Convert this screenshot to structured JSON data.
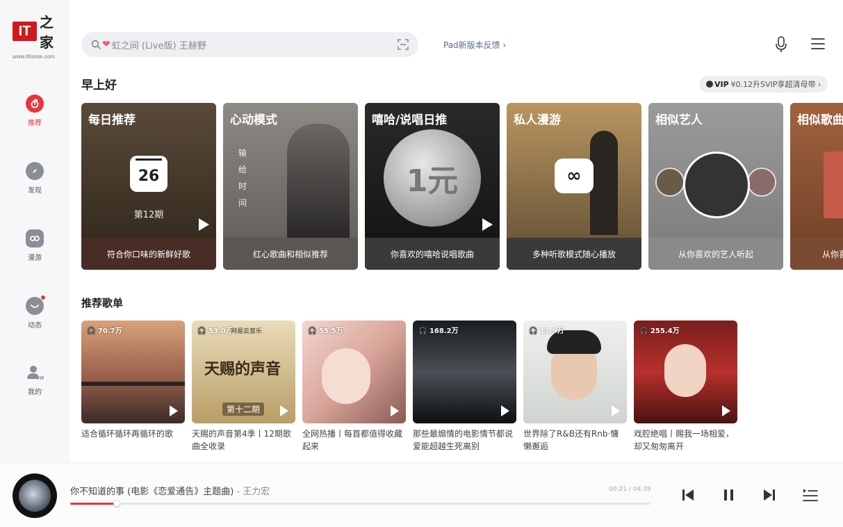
{
  "logo": {
    "brand_mark": "IT",
    "brand_cn": "之家",
    "url": "www.ithome.com"
  },
  "sidebar": {
    "items": [
      {
        "label": "推荐",
        "icon": "netease-note-icon",
        "active": true
      },
      {
        "label": "发现",
        "icon": "compass-icon",
        "active": false
      },
      {
        "label": "漫游",
        "icon": "roam-icon",
        "active": false
      },
      {
        "label": "动态",
        "icon": "moments-icon",
        "active": false,
        "badge_dot": true
      },
      {
        "label": "我的",
        "icon": "user-vip-icon",
        "active": false
      }
    ]
  },
  "search": {
    "placeholder": "虹之间 (Live版) 王赫野",
    "heart": "❤",
    "scan_icon": "scan-icon"
  },
  "header": {
    "feedback": "Pad新版本反馈 ›"
  },
  "greeting": "早上好",
  "vip_pill": {
    "badge": "VIP",
    "text": "¥0.12升SVIP享超清母带 ›"
  },
  "cards": [
    {
      "title": "每日推荐",
      "subtitle": "符合你口味的新鲜好歌",
      "calendar_day": "26",
      "issue": "第12期"
    },
    {
      "title": "心动模式",
      "subtitle": "红心歌曲和相似推荐",
      "vertical_text": "输 给 时 间"
    },
    {
      "title": "嘻哈/说唱日推",
      "subtitle": "你喜欢的嘻哈说唱歌曲",
      "coin_text": "1元"
    },
    {
      "title": "私人漫游",
      "subtitle": "多种听歌模式随心播放",
      "badge": "∞"
    },
    {
      "title": "相似艺人",
      "subtitle": "从你喜欢的艺人听起"
    },
    {
      "title": "相似歌曲",
      "subtitle": "从你喜"
    }
  ],
  "section": {
    "playlists_title": "推荐歌单"
  },
  "playlists": [
    {
      "count": "70.7万",
      "title": "适合循环循环再循环的歌"
    },
    {
      "count": "53.0万",
      "title": "天赐的声音第4季丨12期歌曲全收录",
      "cover_label": "网易云音乐",
      "cover_heading": "天赐的声音",
      "cover_issue": "第十二期"
    },
    {
      "count": "55.5万",
      "title": "全网热播丨每首都值得收藏起来"
    },
    {
      "count": "168.2万",
      "title": "那些最煽情的电影情节都说爱能超越生死离别"
    },
    {
      "count": "11.9万",
      "title": "世界除了R&B还有Rnb·慵懒邂逅"
    },
    {
      "count": "255.4万",
      "title": "戏腔绝唱丨赐我一场相爱，却又匆匆离开"
    }
  ],
  "player": {
    "song": "你不知道的事 (电影《恋爱通告》主题曲)",
    "artist": "王力宏",
    "separator": " - ",
    "time": "00:21 / 04:39",
    "progress": 0.08
  },
  "colors": {
    "accent": "#e8343c",
    "sidebar_icon": "#8a8e97"
  }
}
